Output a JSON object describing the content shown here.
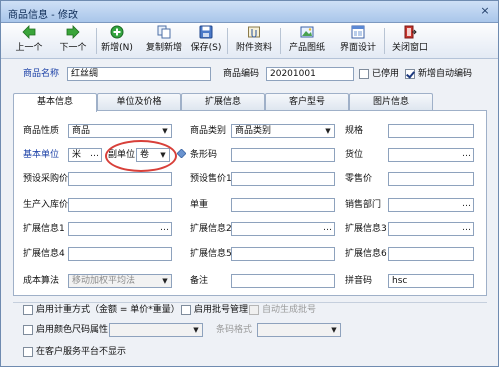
{
  "window": {
    "title": "商品信息 - 修改",
    "close": "×"
  },
  "toolbar": {
    "prev": {
      "label": "上一个",
      "icon": "arrow-left-icon"
    },
    "next": {
      "label": "下一个",
      "icon": "arrow-right-icon"
    },
    "add": {
      "label": "新增(N)",
      "icon": "plus-circle-icon"
    },
    "copy_add": {
      "label": "复制新增",
      "icon": "copy-icon"
    },
    "save": {
      "label": "保存(S)",
      "icon": "save-icon"
    },
    "attachments": {
      "label": "附件资料",
      "icon": "paperclip-icon"
    },
    "product_image": {
      "label": "产品图纸",
      "icon": "image-icon"
    },
    "ui_design": {
      "label": "界面设计",
      "icon": "layout-icon"
    },
    "close": {
      "label": "关闭窗口",
      "icon": "door-exit-icon"
    }
  },
  "header": {
    "name_label": "商品名称",
    "name_value": "红丝绸",
    "code_label": "商品编码",
    "code_value": "20201001",
    "disabled_label": "已停用",
    "disabled_checked": false,
    "auto_code_label": "新增自动编码",
    "auto_code_checked": true
  },
  "tabs": [
    "基本信息",
    "单位及价格",
    "扩展信息",
    "客户型号",
    "图片信息"
  ],
  "active_tab": "基本信息",
  "form": {
    "nature_label": "商品性质",
    "nature_value": "商品",
    "category_label": "商品类别",
    "category_value": "商品类别",
    "spec_label": "规格",
    "spec_value": "",
    "base_unit_label": "基本单位",
    "base_unit_value": "米",
    "sub_unit_label": "副单位",
    "sub_unit_value": "卷",
    "barcode_label": "条形码",
    "barcode_value": "",
    "location_label": "货位",
    "location_value": "",
    "preset_purchase_label": "预设采购价",
    "preset_purchase_value": "",
    "preset_sale_label": "预设售价1",
    "preset_sale_value": "",
    "retail_label": "零售价",
    "retail_value": "",
    "production_label": "生产入库价",
    "production_value": "",
    "weight_label": "单重",
    "weight_value": "",
    "sales_dept_label": "销售部门",
    "sales_dept_value": "",
    "ext1_label": "扩展信息1",
    "ext1_value": "",
    "ext2_label": "扩展信息2",
    "ext2_value": "",
    "ext3_label": "扩展信息3",
    "ext3_value": "",
    "ext4_label": "扩展信息4",
    "ext4_value": "",
    "ext5_label": "扩展信息5",
    "ext5_value": "",
    "ext6_label": "扩展信息6",
    "ext6_value": "",
    "cost_label": "成本算法",
    "cost_value": "移动加权平均法",
    "remark_label": "备注",
    "remark_value": "",
    "pinyin_label": "拼音码",
    "pinyin_value": "hsc"
  },
  "options": {
    "measure_label": "启用计重方式（金额 = 单价*重量）",
    "measure_checked": false,
    "batch_label": "启用批号管理",
    "batch_checked": false,
    "auto_batch_label": "自动生成批号",
    "auto_batch_checked": false,
    "color_size_label": "启用颜色尺码属性",
    "color_size_checked": false,
    "color_size_value": "",
    "barcode_format_label": "条码格式",
    "barcode_format_value": "",
    "hide_platform_label": "在客户服务平台不显示",
    "hide_platform_checked": false
  },
  "colors": {
    "title_bar": "#b8d0ef",
    "accent_label": "#1a3fa6",
    "highlight_oval": "#d8403a"
  }
}
